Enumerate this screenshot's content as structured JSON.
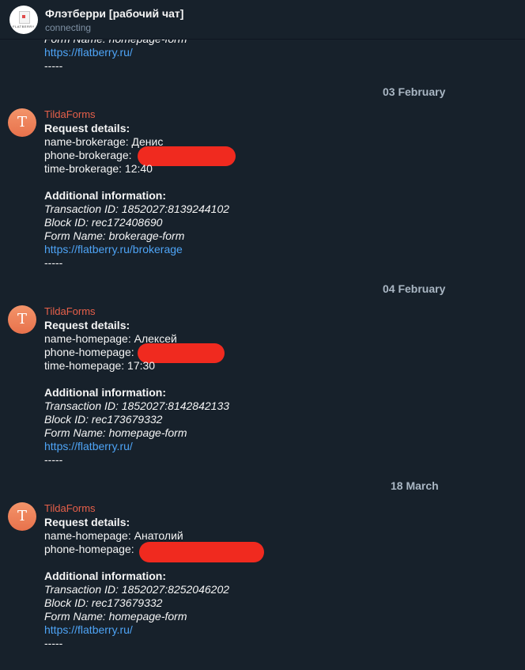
{
  "header": {
    "title": "Флэтберри [рабочий чат]",
    "status": "connecting",
    "avatar_text": "FLATBERRY"
  },
  "top_fragment": {
    "form_name": "Form Name: homepage-form",
    "link": "https://flatberry.ru/",
    "separator": "-----"
  },
  "messages": [
    {
      "date": "03 February",
      "sender": "TildaForms",
      "avatar_letter": "T",
      "request_heading": "Request details:",
      "fields": [
        "name-brokerage: Денис",
        "phone-brokerage:",
        "time-brokerage: 12:40"
      ],
      "additional_heading": "Additional information:",
      "transaction": "Transaction ID: 1852027:8139244102",
      "block": "Block ID: rec172408690",
      "form_name": "Form Name: brokerage-form",
      "link": "https://flatberry.ru/brokerage",
      "separator": "-----"
    },
    {
      "date": "04 February",
      "sender": "TildaForms",
      "avatar_letter": "T",
      "request_heading": "Request details:",
      "fields": [
        "name-homepage: Алексей",
        "phone-homepage:",
        "time-homepage: 17:30"
      ],
      "additional_heading": "Additional information:",
      "transaction": "Transaction ID: 1852027:8142842133",
      "block": "Block ID: rec173679332",
      "form_name": "Form Name: homepage-form",
      "link": "https://flatberry.ru/",
      "separator": "-----"
    },
    {
      "date": "18 March",
      "sender": "TildaForms",
      "avatar_letter": "T",
      "request_heading": "Request details:",
      "fields": [
        "name-homepage: Анатолий",
        "phone-homepage:"
      ],
      "additional_heading": "Additional information:",
      "transaction": "Transaction ID: 1852027:8252046202",
      "block": "Block ID: rec173679332",
      "form_name": "Form Name: homepage-form",
      "link": "https://flatberry.ru/",
      "separator": "-----"
    }
  ]
}
